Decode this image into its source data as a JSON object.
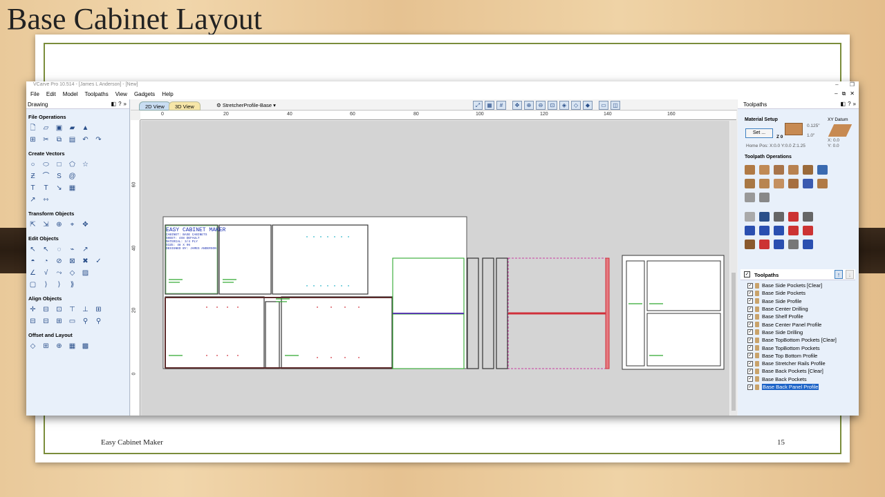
{
  "slide": {
    "title": "Base Cabinet Layout",
    "footer_left": "Easy Cabinet Maker",
    "page_number": "15"
  },
  "app": {
    "window_title": "VCarve Pro 10.514 - [James L Anderson] - [New]",
    "menu": [
      "File",
      "Edit",
      "Model",
      "Toolpaths",
      "View",
      "Gadgets",
      "Help"
    ]
  },
  "drawing_panel": {
    "header": "Drawing",
    "sections": [
      {
        "title": "File Operations",
        "rows": [
          [
            "new-file",
            "open-file",
            "save-file",
            "import-file",
            "import-bitmap"
          ],
          [
            "select-all",
            "cut",
            "copy",
            "paste",
            "undo",
            "redo"
          ]
        ]
      },
      {
        "title": "Create Vectors",
        "rows": [
          [
            "circle",
            "ellipse",
            "rectangle",
            "polygon",
            "star"
          ],
          [
            "polyline",
            "arc",
            "curve",
            "spiral"
          ],
          [
            "text",
            "text-on-curve",
            "dimension",
            "table"
          ],
          [
            "draw-line",
            "measure"
          ]
        ]
      },
      {
        "title": "Transform Objects",
        "rows": [
          [
            "move",
            "set-size",
            "rotate",
            "mirror",
            "align"
          ]
        ]
      },
      {
        "title": "Edit Objects",
        "rows": [
          [
            "node-edit",
            "select",
            "smooth",
            "trim",
            "distort"
          ],
          [
            "weld",
            "subtract",
            "intersect",
            "group",
            "ungroup",
            "fillet"
          ],
          [
            "join",
            "curve-fit",
            "extend",
            "offset",
            "bitmap"
          ],
          [
            "box",
            "bracket-left",
            "bracket-right",
            "close-bracket"
          ]
        ]
      },
      {
        "title": "Align Objects",
        "rows": [
          [
            "center",
            "align-left",
            "align-right",
            "align-top",
            "align-bottom",
            "distribute"
          ],
          [
            "center-h",
            "center-v",
            "spacing-h",
            "spacing-v",
            "lock",
            "unlock"
          ]
        ]
      },
      {
        "title": "Offset and Layout",
        "rows": [
          [
            "offset",
            "nest",
            "array",
            "copy-grid",
            "tile"
          ]
        ]
      }
    ]
  },
  "view_tabs": {
    "tab_2d": "2D View",
    "tab_3d": "3D View",
    "view_select": "StretcherProfile-Base"
  },
  "rulers": {
    "h_ticks": [
      "0",
      "20",
      "40",
      "60",
      "80",
      "100",
      "120",
      "140",
      "160"
    ],
    "v_ticks": [
      "60",
      "40",
      "20",
      "0"
    ]
  },
  "drawing_text": {
    "title": "EASY CABINET MAKER",
    "lines": [
      "CABINET: BASE CABINETS",
      "SHEET: 4X8 DEFAULT",
      "MATERIAL: 3/4 PLY",
      "SIZE: 48 X 96",
      "DESIGNED BY: JAMES ANDERSON"
    ]
  },
  "toolpaths_panel": {
    "header": "Toolpaths",
    "material_setup": "Material Setup",
    "set_button": "Set ...",
    "thickness_1": "0.125\"",
    "thickness_2": "1.0\"",
    "z_zero": "Z 0",
    "home_pos": "Home Pos:  X:0.0 Y:0.0 Z:1.25",
    "xy_datum": "XY Datum",
    "xy_x": "X: 0.0",
    "xy_y": "Y: 0.0",
    "ops_label": "Toolpath Operations",
    "list_header": "Toolpaths",
    "items": [
      "Base Side Pockets [Clear]",
      "Base Side Pockets",
      "Base Side Profile",
      "Base Center Drilling",
      "Base Shelf Profile",
      "Base Center Panel Profile",
      "Base Side Drilling",
      "Base TopBottom Pockets [Clear]",
      "Base TopBottom Pockets",
      "Base Top Bottom Profile",
      "Base Stretcher Rails Profile",
      "Base Back Pockets [Clear]",
      "Base Back Pockets",
      "Base Back Panel Profile"
    ],
    "selected_index": 13
  },
  "colors": {
    "panel_bg": "#e8f0fa",
    "drawing_bg": "#d4d4d4",
    "vector_dark": "#333333",
    "vector_green": "#2fa82f",
    "vector_red": "#d0303a",
    "vector_magenta": "#c83aa0",
    "vector_purple": "#5a3ab0",
    "text_blue": "#1a2fb0",
    "selection": "#1c63c7",
    "frame_green": "#7a8c3a"
  }
}
